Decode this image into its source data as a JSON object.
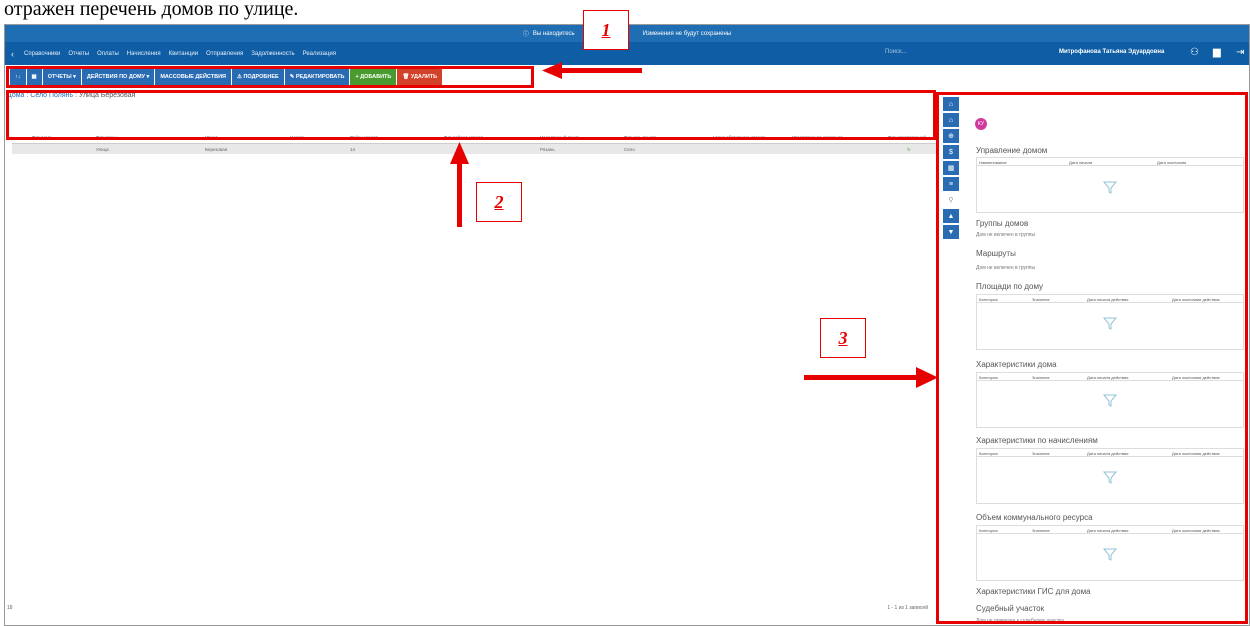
{
  "caption": "отражен перечень домов по улице.",
  "banner": {
    "text_left": "Вы находитесь",
    "text_right": "Изменения не будут сохранены"
  },
  "nav": {
    "items": [
      "Справочники",
      "Отчеты",
      "Оплаты",
      "Начисления",
      "Квитанции",
      "Отправления",
      "Задолженность",
      "Реализация"
    ],
    "search_placeholder": "Поиск...",
    "user": "Митрофанова Татьяна Эдуардовна"
  },
  "toolbar": {
    "reports": "ОТЧЕТЫ",
    "house_actions": "ДЕЙСТВИЯ ПО ДОМУ",
    "mass_actions": "МАССОВЫЕ ДЕЙСТВИЯ",
    "details": "ПОДРОБНЕЕ",
    "edit": "РЕДАКТИРОВАТЬ",
    "add": "ДОБАВИТЬ",
    "delete": "УДАЛИТЬ"
  },
  "breadcrumb": {
    "root": "Дома",
    "village": "Село Полянь",
    "street": "Улица Березовая"
  },
  "grid": {
    "columns": [
      "Тип дома",
      "Тип улицы",
      "Улица",
      "Номер",
      "Район города",
      "Тип района города",
      "Населенный пункт",
      "Тип нас. пункта",
      "Адрес областного отдела",
      "Управляющая компания",
      "Тип управляющей"
    ],
    "filter_row": [
      "Улица",
      "Березовая",
      "14",
      "Рязань",
      "Село"
    ],
    "footer_left": "18",
    "footer_right": "1 - 1 из 1 записей"
  },
  "panel": {
    "avatar": "КУ",
    "sections": [
      {
        "title": "Управление домом",
        "cols": [
          "Наименование",
          "Дата начала",
          "Дата окончания"
        ]
      },
      {
        "title": "Группы домов",
        "note": "Дом не включен в группы"
      },
      {
        "title": "Маршруты",
        "note": "Дом не включен в группы"
      },
      {
        "title": "Площади по дому",
        "cols": [
          "Категория",
          "Значение",
          "Дата начала действия",
          "Дата окончания действия"
        ]
      },
      {
        "title": "Характеристики дома",
        "cols": [
          "Категория",
          "Значение",
          "Дата начала действия",
          "Дата окончания действия"
        ]
      },
      {
        "title": "Характеристики по начислениям",
        "cols": [
          "Категория",
          "Значение",
          "Дата начала действия",
          "Дата окончания действия"
        ]
      },
      {
        "title": "Объем коммунального ресурса",
        "cols": [
          "Категория",
          "Значение",
          "Дата начала действия",
          "Дата окончания действия"
        ]
      },
      {
        "title": "Характеристики ГИС для дома"
      },
      {
        "title": "Судебный участок",
        "note": "Дом не привязан к судебному участку"
      }
    ]
  },
  "annotations": {
    "label1": "1",
    "label2": "2",
    "label3": "3"
  },
  "colors": {
    "annotation": "#e60000",
    "nav": "#0f5da4",
    "button": "#2a6cb3",
    "add": "#4a9b2f",
    "delete": "#d2422a"
  }
}
